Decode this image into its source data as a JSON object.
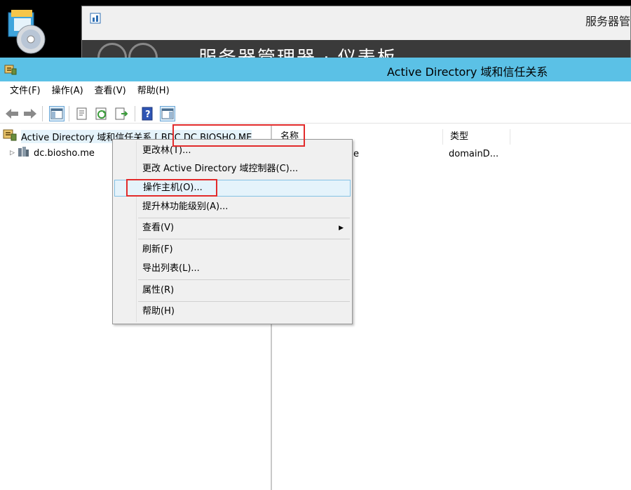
{
  "background_window": {
    "title": "服务器管",
    "breadcrumb": "服务器管理器 · 仪表板"
  },
  "window": {
    "title": "Active Directory 域和信任关系"
  },
  "menubar": {
    "items": [
      "文件(F)",
      "操作(A)",
      "查看(V)",
      "帮助(H)"
    ]
  },
  "tree": {
    "root_label": "Active Directory 域和信任关系 [ BDC.DC.BIOSHO.ME",
    "child_label": "dc.biosho.me"
  },
  "list": {
    "columns": [
      "名称",
      "类型"
    ],
    "rows": [
      {
        "name": "e",
        "type": "domainD..."
      }
    ]
  },
  "context_menu": {
    "items": [
      "更改林(T)...",
      "更改 Active Directory 域控制器(C)...",
      "操作主机(O)...",
      "提升林功能级别(A)...",
      "查看(V)",
      "刷新(F)",
      "导出列表(L)...",
      "属性(R)",
      "帮助(H)"
    ],
    "submenu_arrow": "▶"
  },
  "colors": {
    "titlebar": "#5bc1e6",
    "highlight": "#e5f3fb",
    "annotation": "#e22b2b"
  }
}
